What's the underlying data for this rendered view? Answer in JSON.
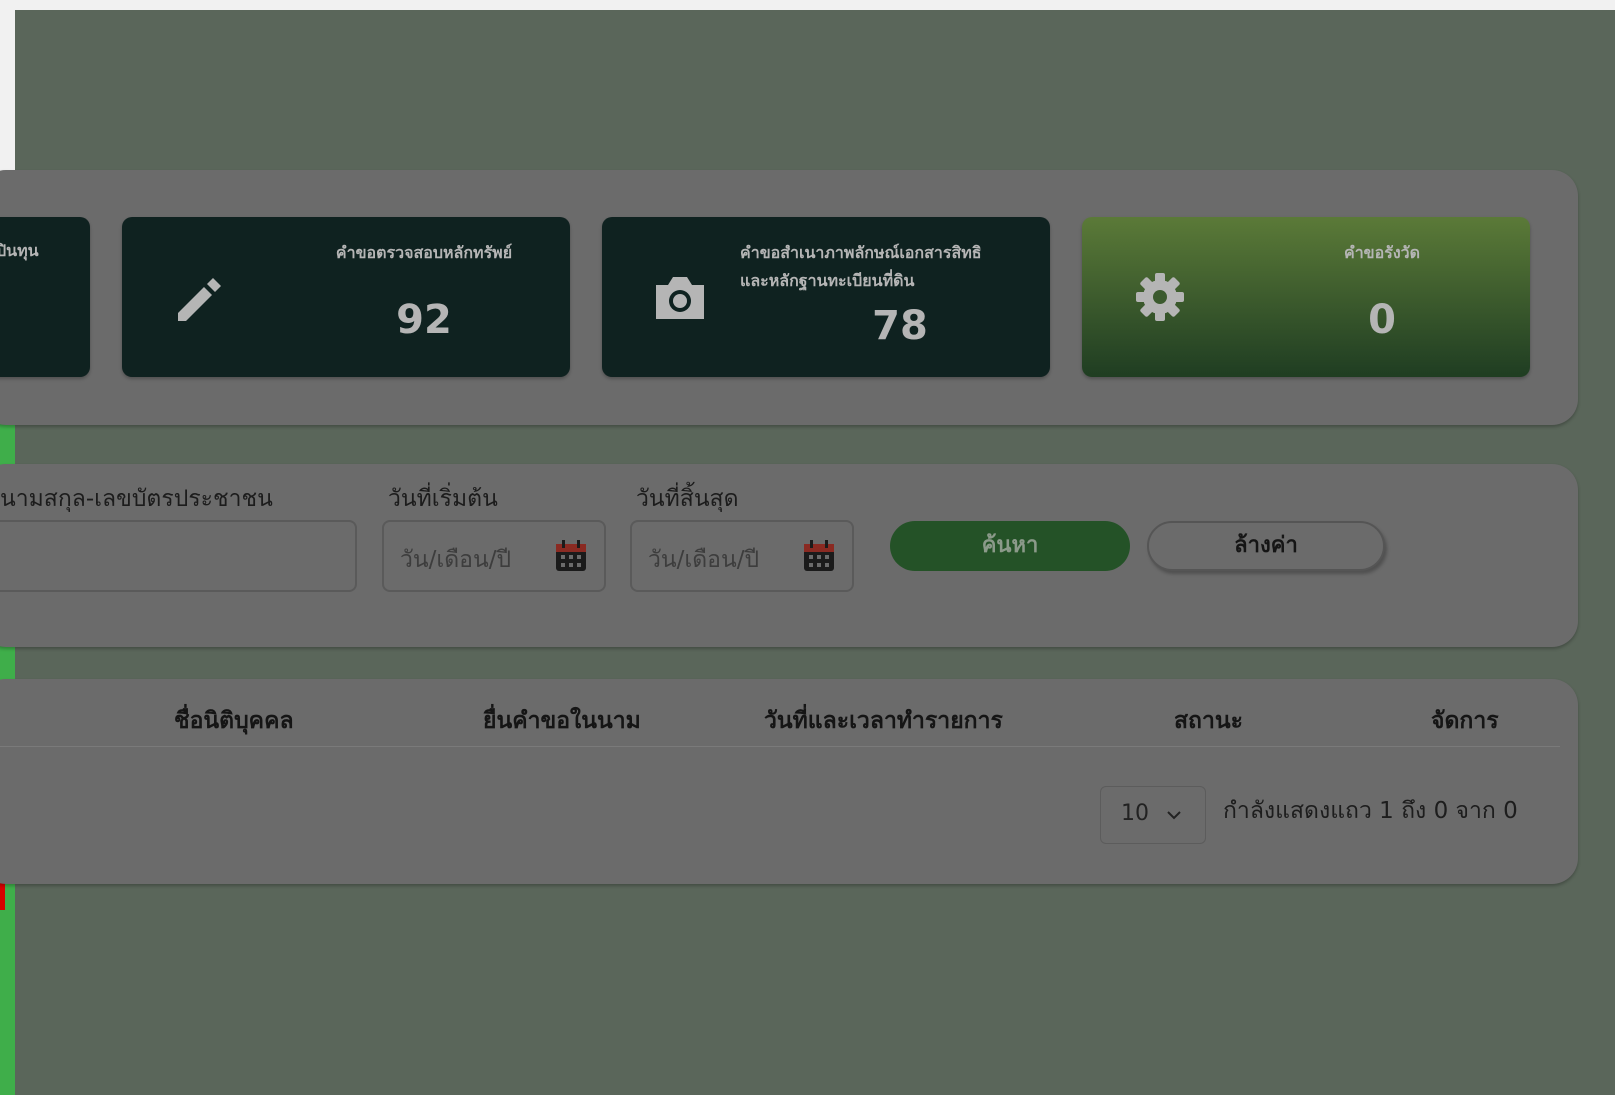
{
  "stats": {
    "cards": [
      {
        "title": "ปินทุน",
        "count": "",
        "icon": "unknown-icon"
      },
      {
        "title": "คำขอตรวจสอบหลักทรัพย์",
        "count": "92",
        "icon": "pencil-icon"
      },
      {
        "title_line1": "คำขอสำเนาภาพลักษณ์เอกสารสิทธิ",
        "title_line2": "และหลักฐานทะเบียนที่ดิน",
        "count": "78",
        "icon": "camera-icon"
      },
      {
        "title": "คำขอรังวัด",
        "count": "0",
        "icon": "gear-icon"
      }
    ]
  },
  "search": {
    "name_label": "นามสกุล-เลขบัตรประชาชน",
    "name_value": "",
    "start_label": "วันที่เริ่มต้น",
    "start_placeholder": "วัน/เดือน/ปี",
    "end_label": "วันที่สิ้นสุด",
    "end_placeholder": "วัน/เดือน/ปี",
    "search_button": "ค้นหา",
    "clear_button": "ล้างค่า"
  },
  "table": {
    "columns": [
      "ชื่อนิติบุคคล",
      "ยื่นคำขอในนาม",
      "วันที่และเวลาทำรายการ",
      "สถานะ",
      "จัดการ"
    ],
    "page_size": "10",
    "page_info": "กำลังแสดงแถว 1 ถึง 0 จาก 0"
  },
  "colors": {
    "accent_green": "#3fae4a",
    "card_dark": "#0f2220",
    "search_button": "#245227",
    "marker_red": "#d80000"
  }
}
